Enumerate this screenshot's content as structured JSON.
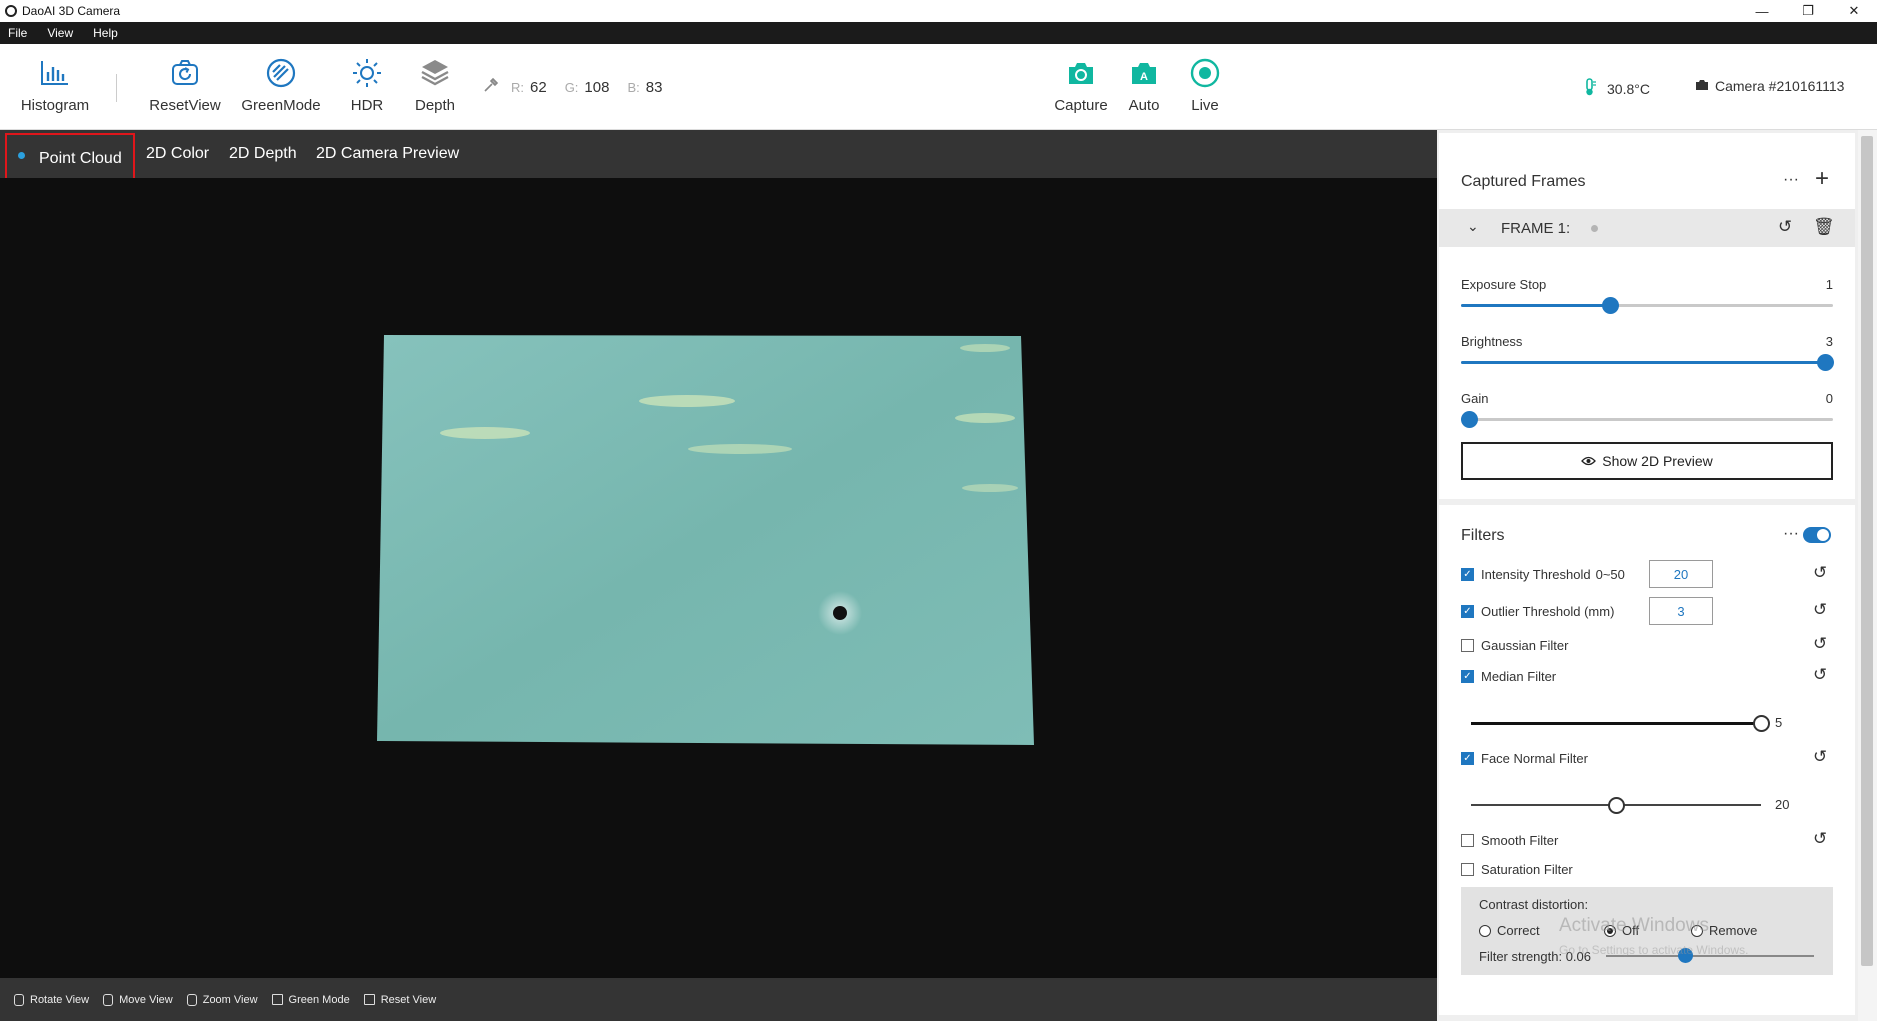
{
  "window": {
    "title": "DaoAI 3D Camera",
    "controls": [
      "—",
      "❐",
      "✕"
    ]
  },
  "menu": [
    "File",
    "View",
    "Help"
  ],
  "toolbar": {
    "histogram": "Histogram",
    "resetview": "ResetView",
    "greenmode": "GreenMode",
    "hdr": "HDR",
    "depth": "Depth",
    "rgb": {
      "r_label": "R:",
      "r": "62",
      "g_label": "G:",
      "g": "108",
      "b_label": "B:",
      "b": "83"
    },
    "capture": "Capture",
    "auto": "Auto",
    "live": "Live",
    "temperature": "30.8°C",
    "camera": "Camera #210161113",
    "accent_color": "#10b7a0"
  },
  "view_tabs": [
    "Point Cloud",
    "2D Color",
    "2D Depth",
    "2D Camera Preview"
  ],
  "active_view_tab": "Point Cloud",
  "hints": [
    "Rotate View",
    "Move View",
    "Zoom View",
    "Green Mode",
    "Reset View"
  ],
  "captured_frames": {
    "title": "Captured Frames",
    "more": "···",
    "add": "+",
    "frame_label": "FRAME 1:",
    "sliders": [
      {
        "label": "Exposure Stop",
        "value": "1",
        "fraction": 0.4
      },
      {
        "label": "Brightness",
        "value": "3",
        "fraction": 1.0
      },
      {
        "label": "Gain",
        "value": "0",
        "fraction": 0.0
      }
    ],
    "show_preview": "Show 2D Preview"
  },
  "filters": {
    "title": "Filters",
    "more": "···",
    "enabled": true,
    "intensity": {
      "label": "Intensity Threshold",
      "range": "0~50",
      "value": "20",
      "checked": true
    },
    "outlier": {
      "label": "Outlier Threshold (mm)",
      "value": "3",
      "checked": true
    },
    "gaussian": {
      "label": "Gaussian Filter",
      "checked": false
    },
    "median": {
      "label": "Median Filter",
      "checked": true,
      "value": "5",
      "fraction": 1.0
    },
    "face_normal": {
      "label": "Face Normal Filter",
      "checked": true,
      "value": "20",
      "fraction": 0.5
    },
    "smooth": {
      "label": "Smooth Filter",
      "checked": false
    },
    "saturation": {
      "label": "Saturation Filter",
      "checked": false
    },
    "contrast": {
      "title": "Contrast distortion:",
      "options": [
        "Correct",
        "Off",
        "Remove"
      ],
      "selected": "Off",
      "strength_label": "Filter strength: 0.06"
    }
  },
  "watermark": {
    "line1": "Activate Windows",
    "line2": "Go to Settings to activate Windows."
  }
}
